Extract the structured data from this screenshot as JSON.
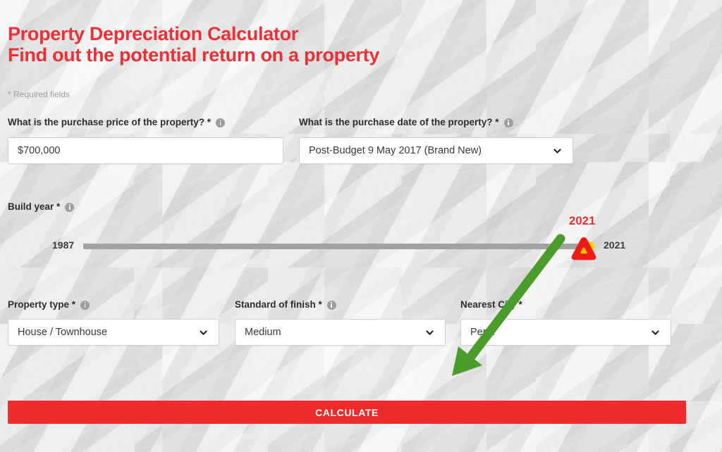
{
  "header": {
    "title_line1": "Property Depreciation Calculator",
    "title_line2": "Find out the potential return on a property",
    "required_note": "* Required fields",
    "brand_red": "#ef2b2b"
  },
  "form": {
    "purchase_price": {
      "label": "What is the purchase price of the property? *",
      "info_icon": "info-icon",
      "value": "$700,000",
      "placeholder": "$700,000"
    },
    "purchase_date": {
      "label": "What is the purchase date of the property? *",
      "info_icon": "info-icon",
      "value": "Post-Budget 9 May 2017 (Brand New)",
      "chevron_icon": "chevron-down-icon"
    },
    "build_year": {
      "label": "Build year *",
      "info_icon": "info-icon",
      "min_label": "1987",
      "max_label": "2021",
      "selected_value": "2021",
      "bubble_color": "#ef2b2b",
      "track_color": "#a2a2a2",
      "thumb_color": "#f5d400"
    },
    "property_type": {
      "label": "Property type *",
      "info_icon": "info-icon",
      "value": "House / Townhouse",
      "chevron_icon": "chevron-down-icon"
    },
    "standard_of_finish": {
      "label": "Standard of finish *",
      "info_icon": "info-icon",
      "value": "Medium",
      "chevron_icon": "chevron-down-icon"
    },
    "nearest_city": {
      "label": "Nearest City *",
      "value": "Perth",
      "chevron_icon": "chevron-down-icon"
    }
  },
  "actions": {
    "calculate_label": "CALCULATE"
  },
  "annotation": {
    "arrow_color": "#4a9d2a",
    "cursor_marker_color": "#ef1b14",
    "cursor_marker_inner_color": "#f5c400"
  }
}
